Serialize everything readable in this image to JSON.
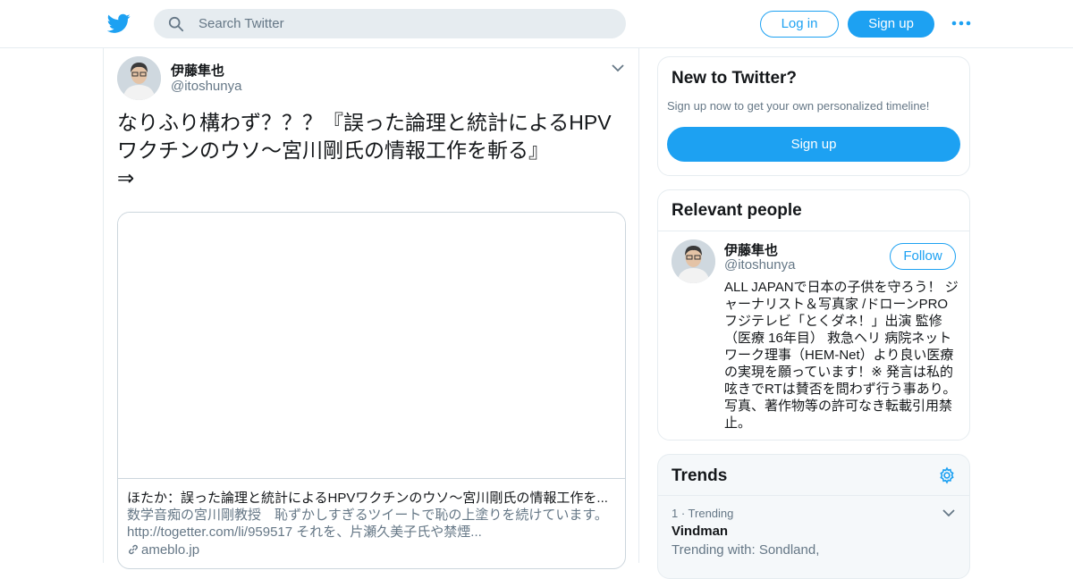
{
  "header": {
    "search_placeholder": "Search Twitter",
    "login_label": "Log in",
    "signup_label": "Sign up",
    "accent_color": "#1da1f2"
  },
  "tweet": {
    "author_name": "伊藤隼也",
    "author_handle": "@itoshunya",
    "text_line1": "なりふり構わず？？？『誤った論理と統計によるHPV",
    "text_line2": "ワクチンのウソ～宮川剛氏の情報工作を斬る』",
    "text_line3": "⇒",
    "card": {
      "title": "ほたか：誤った論理と統計によるHPVワクチンのウソ～宮川剛氏の情報工作を...",
      "desc_line1": "数学音痴の宮川剛教授　恥ずかしすぎるツイートで恥の上塗りを続けています。",
      "desc_line2": "http://togetter.com/li/959517 それを、片瀬久美子氏や禁煙...",
      "domain": "ameblo.jp"
    }
  },
  "sidebar": {
    "new_to_twitter": {
      "title": "New to Twitter?",
      "subtitle": "Sign up now to get your own personalized timeline!",
      "button": "Sign up"
    },
    "relevant_people": {
      "title": "Relevant people",
      "name": "伊藤隼也",
      "handle": "@itoshunya",
      "follow_label": "Follow",
      "bio": "ALL JAPANで日本の子供を守ろう！ ジャーナリスト＆写真家 /ドローンPRO フジテレビ「とくダネ！」出演 監修（医療 16年目） 救急ヘリ 病院ネットワーク理事（HEM-Net）より良い医療の実現を願っています！※ 発言は私的呟きでRTは賛否を問わず行う事あり。写真、著作物等の許可なき転載引用禁止。"
    },
    "trends": {
      "title": "Trends",
      "item_meta": "1 · Trending",
      "item_name": "Vindman",
      "item_with": "Trending with: Sondland,"
    }
  }
}
